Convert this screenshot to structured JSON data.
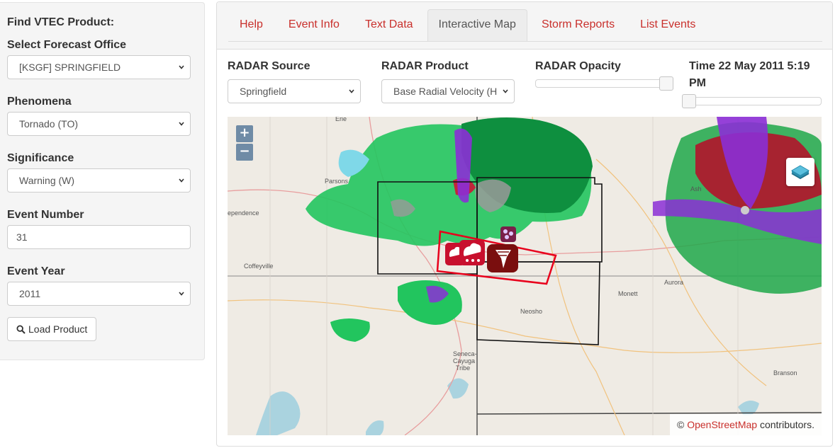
{
  "sidebar": {
    "title": "Find VTEC Product:",
    "office_label": "Select Forecast Office",
    "office_value": "[KSGF] SPRINGFIELD",
    "phenomena_label": "Phenomena",
    "phenomena_value": "Tornado (TO)",
    "significance_label": "Significance",
    "significance_value": "Warning (W)",
    "event_number_label": "Event Number",
    "event_number_value": "31",
    "event_year_label": "Event Year",
    "event_year_value": "2011",
    "load_button": "Load Product",
    "search_icon": "search-icon"
  },
  "tabs": [
    {
      "label": "Help"
    },
    {
      "label": "Event Info"
    },
    {
      "label": "Text Data"
    },
    {
      "label": "Interactive Map"
    },
    {
      "label": "Storm Reports"
    },
    {
      "label": "List Events"
    }
  ],
  "active_tab": "Interactive Map",
  "controls": {
    "radar_source_label": "RADAR Source",
    "radar_source_value": "Springfield",
    "radar_product_label": "RADAR Product",
    "radar_product_value": "Base Radial Velocity (H",
    "radar_opacity_label": "RADAR Opacity",
    "radar_opacity_level": 1.0,
    "time_label": "Time 22 May 2011 5:19 PM",
    "time_slider_level": 0.0
  },
  "map": {
    "zoom_in": "+",
    "zoom_out": "−",
    "layers_icon": "layers-icon",
    "attribution_prefix": "©",
    "attribution_link": "OpenStreetMap",
    "attribution_suffix": "contributors.",
    "place_labels": {
      "erie": "Erie",
      "parsons": "Parsons",
      "independence": "ependence",
      "coffeyville": "Coffeyville",
      "neosho": "Neosho",
      "monett": "Monett",
      "aurora": "Aurora",
      "branson": "Branson",
      "seneca": "Seneca-",
      "cayuga": "Cayuga",
      "tribe": "Tribe",
      "ash": "Ash"
    },
    "warning_color": "#e8001c",
    "markers": [
      "wind-report-icon",
      "hail-report-icon",
      "tornado-report-icon"
    ]
  }
}
